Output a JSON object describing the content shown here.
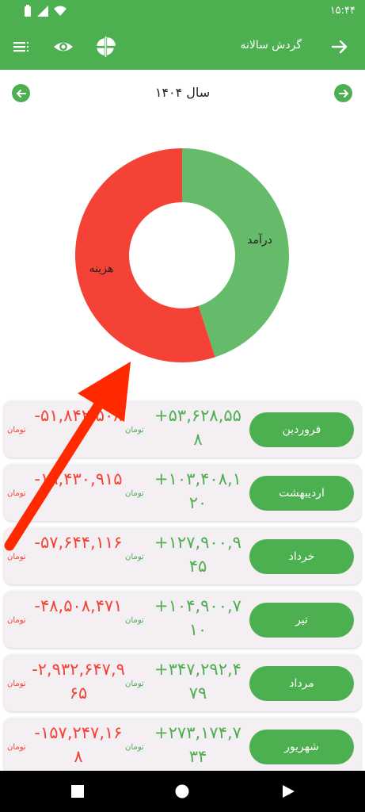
{
  "status": {
    "time": "۱۵:۴۴"
  },
  "appbar": {
    "title": "گردش سالانه",
    "back_icon": "arrow-forward-icon",
    "menu_icon": "sort-list-icon",
    "eye_icon": "eye-icon",
    "pie_icon": "pie-chart-icon"
  },
  "year": {
    "label": "سال ۱۴۰۴"
  },
  "colors": {
    "green": "#4caf50",
    "income": "#66bb6a",
    "expense": "#f44336"
  },
  "chart_data": {
    "type": "pie",
    "slices": [
      {
        "label": "درآمد",
        "value": 0.45
      },
      {
        "label": "هزینه",
        "value": 0.55
      }
    ]
  },
  "months": [
    {
      "name": "فروردین",
      "income": "+۵۳,۶۲۸,۵۵۸",
      "income_unit": "تومان",
      "expense": "-۵۱,۸۴۲,۵۰۸",
      "expense_unit": "تومان"
    },
    {
      "name": "اردیبهشت",
      "income": "+۱۰۳,۴۰۸,۱۲۰",
      "income_unit": "تومان",
      "expense": "-۱۹,۴۳۰,۹۱۵",
      "expense_unit": "تومان"
    },
    {
      "name": "خرداد",
      "income": "+۱۲۷,۹۰۰,۹۴۵",
      "income_unit": "تومان",
      "expense": "-۵۷,۶۴۴,۱۱۶",
      "expense_unit": "تومان"
    },
    {
      "name": "تیر",
      "income": "+۱۰۴,۹۰۰,۷۱۰",
      "income_unit": "تومان",
      "expense": "-۴۸,۵۰۸,۴۷۱",
      "expense_unit": "تومان"
    },
    {
      "name": "مرداد",
      "income": "+۳۴۷,۲۹۲,۴۷۹",
      "income_unit": "تومان",
      "expense": "-۲,۹۳۲,۶۴۷,۹۶۵",
      "expense_unit": "تومان"
    },
    {
      "name": "شهریور",
      "income": "+۲۷۳,۱۷۴,۷۳۴",
      "income_unit": "تومان",
      "expense": "-۱۵۷,۲۴۷,۱۶۸",
      "expense_unit": "تومان"
    }
  ]
}
